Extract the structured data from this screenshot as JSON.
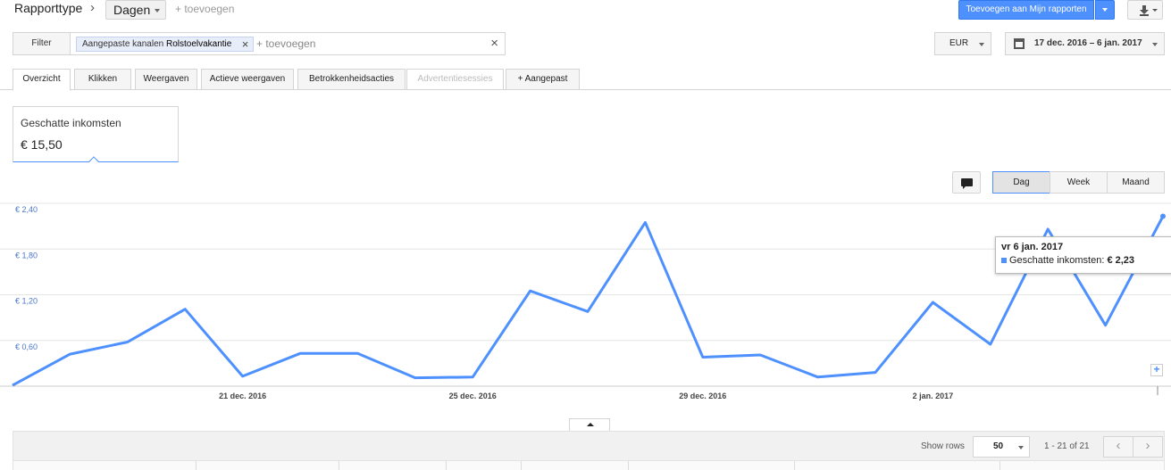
{
  "header": {
    "title": "Rapporttype",
    "period_select": "Dagen",
    "add_link": "+ toevoegen",
    "add_to_reports": "Toevoegen aan Mijn rapporten",
    "download_icon": "download-icon"
  },
  "filter": {
    "label": "Filter",
    "chip_prefix": "Aangepaste kanalen",
    "chip_value": "Rolstoelvakantie",
    "chip_remove": "×",
    "add_placeholder": "+ toevoegen",
    "clear": "×"
  },
  "currency": "EUR",
  "date_range": "17 dec. 2016 – 6 jan. 2017",
  "tabs": [
    "Overzicht",
    "Klikken",
    "Weergaven",
    "Actieve weergaven",
    "Betrokkenheidsacties",
    "Advertentiesessies",
    "+ Aangepast"
  ],
  "scorecard": {
    "label": "Geschatte inkomsten",
    "value": "€ 15,50"
  },
  "granularity": [
    "Dag",
    "Week",
    "Maand"
  ],
  "chart_data": {
    "type": "line",
    "series": [
      {
        "name": "Geschatte inkomsten",
        "color": "#4d90fe",
        "values": [
          0.01,
          0.42,
          0.58,
          1.01,
          0.13,
          0.43,
          0.43,
          0.11,
          0.12,
          1.25,
          0.98,
          2.15,
          0.38,
          0.41,
          0.12,
          0.18,
          1.1,
          0.55,
          2.06,
          0.8,
          2.23
        ]
      }
    ],
    "x": [
      "17 dec.",
      "18 dec.",
      "19 dec.",
      "20 dec.",
      "21 dec. 2016",
      "22 dec.",
      "23 dec.",
      "24 dec.",
      "25 dec. 2016",
      "26 dec.",
      "27 dec.",
      "28 dec.",
      "29 dec. 2016",
      "30 dec.",
      "31 dec.",
      "1 jan.",
      "2 jan. 2017",
      "3 jan.",
      "4 jan.",
      "5 jan.",
      "6 jan."
    ],
    "x_tick_labels": [
      "21 dec. 2016",
      "25 dec. 2016",
      "29 dec. 2016",
      "2 jan. 2017"
    ],
    "y_tick_labels": [
      "€ 2,40",
      "€ 1,80",
      "€ 1,20",
      "€ 0,60"
    ],
    "ylim": [
      0,
      2.4
    ],
    "grid": true
  },
  "tooltip": {
    "title": "vr 6 jan. 2017",
    "label": "Geschatte inkomsten:",
    "value": "€ 2,23"
  },
  "table": {
    "show_rows_label": "Show rows",
    "rows_value": "50",
    "range": "1 - 21 of 21",
    "prev": "‹",
    "next": "›"
  }
}
